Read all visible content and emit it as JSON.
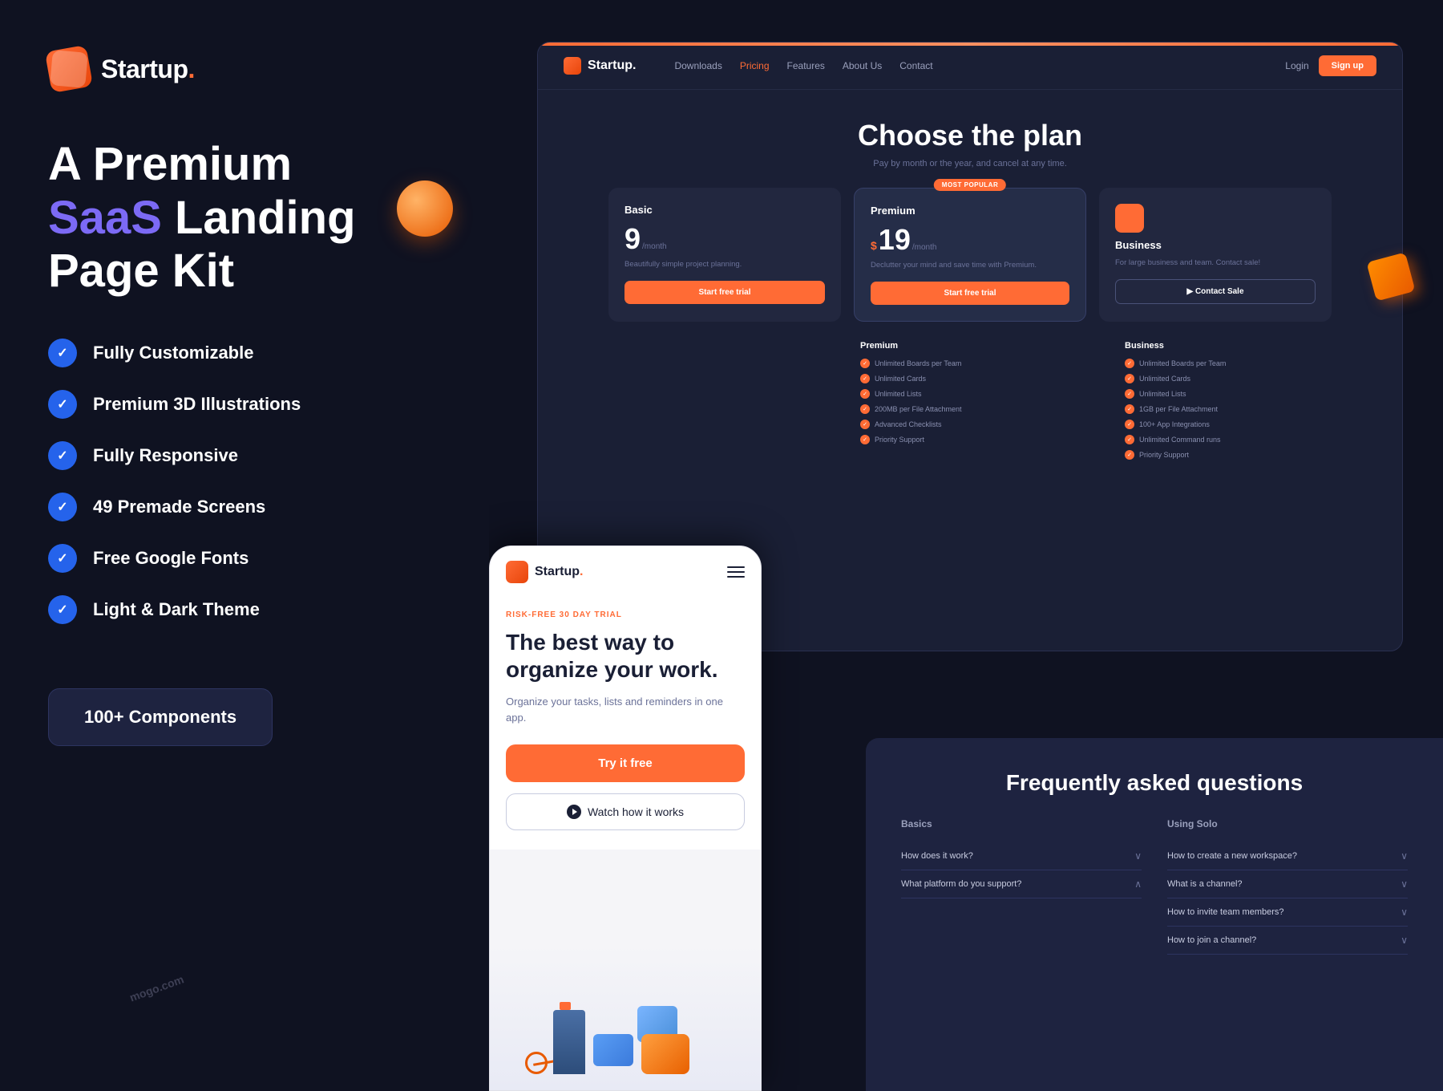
{
  "brand": {
    "name": "Startup",
    "dot": "."
  },
  "left": {
    "headline_line1": "A Premium",
    "headline_line2_plain": "",
    "headline_saas": "SaaS",
    "headline_line2_rest": " Landing",
    "headline_line3": "Page Kit",
    "features": [
      "Fully Customizable",
      "Premium 3D Illustrations",
      "Fully Responsive",
      "49 Premade Screens",
      "Free Google Fonts",
      "Light & Dark Theme"
    ],
    "components_btn": "100+ Components"
  },
  "desktop": {
    "nav": {
      "logo": "Startup.",
      "links": [
        "Downloads",
        "Pricing",
        "Features",
        "About Us",
        "Contact"
      ],
      "active_link": "Pricing",
      "login": "Login",
      "signup": "Sign up"
    },
    "pricing": {
      "title": "Choose the plan",
      "subtitle": "Pay by month or the year, and cancel at any time.",
      "cards": [
        {
          "tier": "Basic",
          "price": "9",
          "has_dollar": false,
          "period": "/month",
          "desc": "Beautifully simple project planning.",
          "cta": "Start free trial",
          "cta_style": "orange"
        },
        {
          "tier": "Premium",
          "price": "19",
          "has_dollar": true,
          "period": "/month",
          "desc": "Declutter your mind and save time with Premium.",
          "cta": "Start free trial",
          "cta_style": "orange",
          "badge": "MOST POPULAR"
        },
        {
          "tier": "Business",
          "price": "",
          "has_dollar": false,
          "period": "",
          "desc": "For large business and team. Contact sale!",
          "cta": "Contact Sale",
          "cta_style": "outline"
        }
      ]
    },
    "features_cols": [
      {
        "title": "Premium",
        "items": [
          "Unlimited Boards per Team",
          "Unlimited Cards",
          "Unlimited Lists",
          "200MB per File Attachment",
          "Advanced Checklists",
          "Priority Support"
        ]
      },
      {
        "title": "Business",
        "items": [
          "Unlimited Boards per Team",
          "Unlimited Cards",
          "Unlimited Lists",
          "1GB per File Attachment",
          "100+ App Integrations",
          "Unlimited Command runs",
          "Priority Support"
        ]
      }
    ]
  },
  "mobile": {
    "logo": "Startup.",
    "badge": "RISK-FREE 30 DAY TRIAL",
    "headline": "The best way to organize your work.",
    "subtext": "Organize your tasks, lists and reminders in one app.",
    "cta_primary": "Try it free",
    "cta_secondary": "Watch how it works"
  },
  "faq": {
    "title": "Frequently asked questions",
    "cols": [
      {
        "title": "Basics",
        "items": [
          "How does it work?",
          "What platform do you support?"
        ]
      },
      {
        "title": "Using Solo",
        "items": [
          "How to create a new workspace?",
          "What is a channel?",
          "How to invite team members?",
          "How to join a channel?"
        ]
      }
    ]
  },
  "watermark": "mogo.com"
}
